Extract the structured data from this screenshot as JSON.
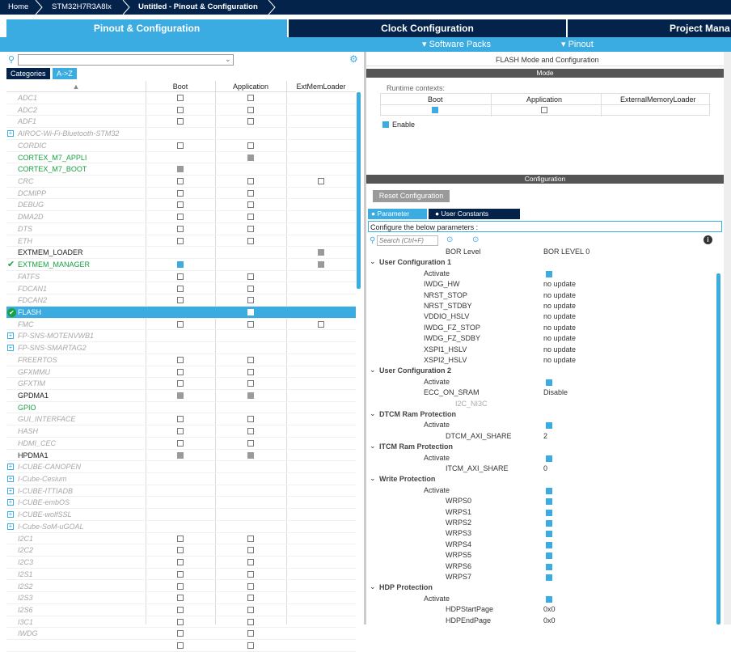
{
  "breadcrumb": {
    "home": "Home",
    "device": "STM32H7R3A8Ix",
    "current": "Untitled - Pinout & Configuration"
  },
  "tabs": {
    "pinout": "Pinout & Configuration",
    "clock": "Clock Configuration",
    "project": "Project Mana"
  },
  "subbar": {
    "software_packs": "Software Packs",
    "pinout": "Pinout"
  },
  "left": {
    "sort_tabs": [
      "Categories",
      "A->Z"
    ],
    "columns": [
      "Boot",
      "Application",
      "ExtMemLoader"
    ],
    "rows": [
      {
        "name": "ADC1",
        "state": "dis",
        "boot": "box",
        "app": "box",
        "ext": ""
      },
      {
        "name": "ADC2",
        "state": "dis",
        "boot": "box",
        "app": "box",
        "ext": ""
      },
      {
        "name": "ADF1",
        "state": "dis",
        "boot": "box",
        "app": "box",
        "ext": ""
      },
      {
        "name": "AIROC-Wi-Fi-Bluetooth-STM32",
        "state": "grp",
        "boot": "",
        "app": "",
        "ext": ""
      },
      {
        "name": "CORDIC",
        "state": "dis",
        "boot": "box",
        "app": "box",
        "ext": ""
      },
      {
        "name": "CORTEX_M7_APPLI",
        "state": "grn",
        "boot": "",
        "app": "gray",
        "ext": ""
      },
      {
        "name": "CORTEX_M7_BOOT",
        "state": "grn",
        "boot": "gray",
        "app": "",
        "ext": ""
      },
      {
        "name": "CRC",
        "state": "dis",
        "boot": "box",
        "app": "box",
        "ext": "box"
      },
      {
        "name": "DCMIPP",
        "state": "dis",
        "boot": "box",
        "app": "box",
        "ext": ""
      },
      {
        "name": "DEBUG",
        "state": "dis",
        "boot": "box",
        "app": "box",
        "ext": ""
      },
      {
        "name": "DMA2D",
        "state": "dis",
        "boot": "box",
        "app": "box",
        "ext": ""
      },
      {
        "name": "DTS",
        "state": "dis",
        "boot": "box",
        "app": "box",
        "ext": ""
      },
      {
        "name": "ETH",
        "state": "dis",
        "boot": "box",
        "app": "box",
        "ext": ""
      },
      {
        "name": "EXTMEM_LOADER",
        "state": "en",
        "boot": "",
        "app": "",
        "ext": "gray"
      },
      {
        "name": "EXTMEM_MANAGER",
        "state": "grnok",
        "boot": "chk",
        "app": "",
        "ext": "gray"
      },
      {
        "name": "FATFS",
        "state": "dis",
        "boot": "box",
        "app": "box",
        "ext": ""
      },
      {
        "name": "FDCAN1",
        "state": "dis",
        "boot": "box",
        "app": "box",
        "ext": ""
      },
      {
        "name": "FDCAN2",
        "state": "dis",
        "boot": "box",
        "app": "box",
        "ext": ""
      },
      {
        "name": "FLASH",
        "state": "sel",
        "boot": "chk",
        "app": "white",
        "ext": ""
      },
      {
        "name": "FMC",
        "state": "dis",
        "boot": "box",
        "app": "box",
        "ext": "box"
      },
      {
        "name": "FP-SNS-MOTENVWB1",
        "state": "grp",
        "boot": "",
        "app": "",
        "ext": ""
      },
      {
        "name": "FP-SNS-SMARTAG2",
        "state": "grp",
        "boot": "",
        "app": "",
        "ext": ""
      },
      {
        "name": "FREERTOS",
        "state": "dis",
        "boot": "box",
        "app": "box",
        "ext": ""
      },
      {
        "name": "GFXMMU",
        "state": "dis",
        "boot": "box",
        "app": "box",
        "ext": ""
      },
      {
        "name": "GFXTIM",
        "state": "dis",
        "boot": "box",
        "app": "box",
        "ext": ""
      },
      {
        "name": "GPDMA1",
        "state": "en",
        "boot": "gray",
        "app": "gray",
        "ext": ""
      },
      {
        "name": "GPIO",
        "state": "grn",
        "boot": "",
        "app": "",
        "ext": ""
      },
      {
        "name": "GUI_INTERFACE",
        "state": "dis",
        "boot": "box",
        "app": "box",
        "ext": ""
      },
      {
        "name": "HASH",
        "state": "dis",
        "boot": "box",
        "app": "box",
        "ext": ""
      },
      {
        "name": "HDMI_CEC",
        "state": "dis",
        "boot": "box",
        "app": "box",
        "ext": ""
      },
      {
        "name": "HPDMA1",
        "state": "en",
        "boot": "gray",
        "app": "gray",
        "ext": ""
      },
      {
        "name": "I-CUBE-CANOPEN",
        "state": "grp",
        "boot": "",
        "app": "",
        "ext": ""
      },
      {
        "name": "I-Cube-Cesium",
        "state": "grp",
        "boot": "",
        "app": "",
        "ext": ""
      },
      {
        "name": "I-CUBE-ITTIADB",
        "state": "grp",
        "boot": "",
        "app": "",
        "ext": ""
      },
      {
        "name": "I-CUBE-embOS",
        "state": "grp",
        "boot": "",
        "app": "",
        "ext": ""
      },
      {
        "name": "I-CUBE-wolfSSL",
        "state": "grp",
        "boot": "",
        "app": "",
        "ext": ""
      },
      {
        "name": "I-Cube-SoM-uGOAL",
        "state": "grp",
        "boot": "",
        "app": "",
        "ext": ""
      },
      {
        "name": "I2C1",
        "state": "dis",
        "boot": "box",
        "app": "box",
        "ext": ""
      },
      {
        "name": "I2C2",
        "state": "dis",
        "boot": "box",
        "app": "box",
        "ext": ""
      },
      {
        "name": "I2C3",
        "state": "dis",
        "boot": "box",
        "app": "box",
        "ext": ""
      },
      {
        "name": "I2S1",
        "state": "dis",
        "boot": "box",
        "app": "box",
        "ext": ""
      },
      {
        "name": "I2S2",
        "state": "dis",
        "boot": "box",
        "app": "box",
        "ext": ""
      },
      {
        "name": "I2S3",
        "state": "dis",
        "boot": "box",
        "app": "box",
        "ext": ""
      },
      {
        "name": "I2S6",
        "state": "dis",
        "boot": "box",
        "app": "box",
        "ext": ""
      },
      {
        "name": "I3C1",
        "state": "dis",
        "boot": "box",
        "app": "box",
        "ext": ""
      },
      {
        "name": "IWDG",
        "state": "dis",
        "boot": "box",
        "app": "box",
        "ext": ""
      },
      {
        "name": "",
        "state": "dis",
        "boot": "box",
        "app": "box",
        "ext": ""
      }
    ]
  },
  "right": {
    "title": "FLASH Mode and Configuration",
    "mode_bar": "Mode",
    "runtime_label": "Runtime contexts:",
    "ctx_cols": [
      "Boot",
      "Application",
      "ExternalMemoryLoader"
    ],
    "enable_label": "Enable",
    "config_bar": "Configuration",
    "reset_button": "Reset Configuration",
    "subtabs": [
      "Parameter Settings",
      "User Constants"
    ],
    "configure_label": "Configure the below parameters :",
    "search_placeholder": "Search (Ctrl+F)",
    "params": [
      {
        "kind": "param",
        "indent": 2,
        "label": "BOR Level",
        "value": "BOR LEVEL 0"
      },
      {
        "kind": "group",
        "label": "User Configuration 1"
      },
      {
        "kind": "param",
        "indent": 1,
        "label": "Activate",
        "value": "check"
      },
      {
        "kind": "param",
        "indent": 1,
        "label": "IWDG_HW",
        "value": "no update"
      },
      {
        "kind": "param",
        "indent": 1,
        "label": "NRST_STOP",
        "value": "no update"
      },
      {
        "kind": "param",
        "indent": 1,
        "label": "NRST_STDBY",
        "value": "no update"
      },
      {
        "kind": "param",
        "indent": 1,
        "label": "VDDIO_HSLV",
        "value": "no update"
      },
      {
        "kind": "param",
        "indent": 1,
        "label": "IWDG_FZ_STOP",
        "value": "no update"
      },
      {
        "kind": "param",
        "indent": 1,
        "label": "IWDG_FZ_SDBY",
        "value": "no update"
      },
      {
        "kind": "param",
        "indent": 1,
        "label": "XSPI1_HSLV",
        "value": "no update"
      },
      {
        "kind": "param",
        "indent": 1,
        "label": "XSPI2_HSLV",
        "value": "no update"
      },
      {
        "kind": "group",
        "label": "User Configuration 2"
      },
      {
        "kind": "param",
        "indent": 1,
        "label": "Activate",
        "value": "check"
      },
      {
        "kind": "param",
        "indent": 1,
        "label": "ECC_ON_SRAM",
        "value": "Disable"
      },
      {
        "kind": "param",
        "indent": 3,
        "label": "I2C_NI3C",
        "value": "",
        "muted": true
      },
      {
        "kind": "group",
        "label": "DTCM Ram Protection"
      },
      {
        "kind": "param",
        "indent": 1,
        "label": "Activate",
        "value": "check"
      },
      {
        "kind": "param",
        "indent": 2,
        "label": "DTCM_AXI_SHARE",
        "value": "2"
      },
      {
        "kind": "group",
        "label": "ITCM Ram Protection"
      },
      {
        "kind": "param",
        "indent": 1,
        "label": "Activate",
        "value": "check"
      },
      {
        "kind": "param",
        "indent": 2,
        "label": "ITCM_AXI_SHARE",
        "value": "0"
      },
      {
        "kind": "group",
        "label": "Write Protection"
      },
      {
        "kind": "param",
        "indent": 1,
        "label": "Activate",
        "value": "check"
      },
      {
        "kind": "param",
        "indent": 2,
        "label": "WRPS0",
        "value": "check"
      },
      {
        "kind": "param",
        "indent": 2,
        "label": "WRPS1",
        "value": "check"
      },
      {
        "kind": "param",
        "indent": 2,
        "label": "WRPS2",
        "value": "check"
      },
      {
        "kind": "param",
        "indent": 2,
        "label": "WRPS3",
        "value": "check"
      },
      {
        "kind": "param",
        "indent": 2,
        "label": "WRPS4",
        "value": "check"
      },
      {
        "kind": "param",
        "indent": 2,
        "label": "WRPS5",
        "value": "check"
      },
      {
        "kind": "param",
        "indent": 2,
        "label": "WRPS6",
        "value": "check"
      },
      {
        "kind": "param",
        "indent": 2,
        "label": "WRPS7",
        "value": "check"
      },
      {
        "kind": "group",
        "label": "HDP Protection"
      },
      {
        "kind": "param",
        "indent": 1,
        "label": "Activate",
        "value": "check"
      },
      {
        "kind": "param",
        "indent": 2,
        "label": "HDPStartPage",
        "value": "0x0"
      },
      {
        "kind": "param",
        "indent": 2,
        "label": "HDPEndPage",
        "value": "0x0"
      }
    ]
  },
  "colors": {
    "accent": "#3bace2",
    "navy": "#03234b",
    "green": "#19a141",
    "bar_gray": "#555555"
  }
}
